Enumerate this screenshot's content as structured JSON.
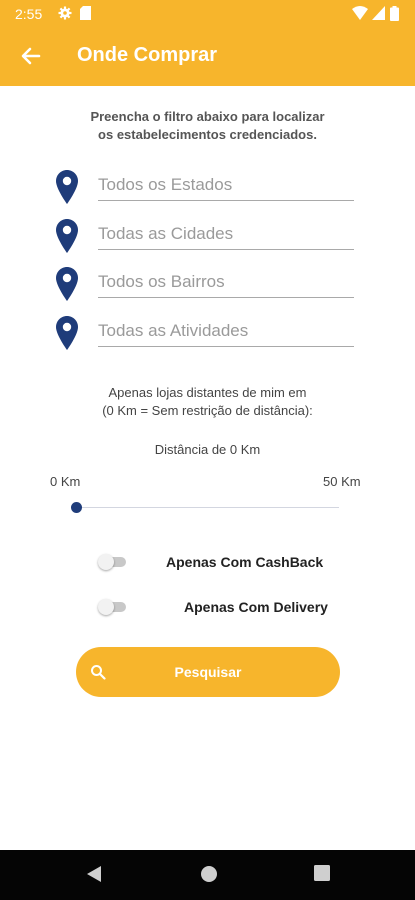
{
  "status_bar": {
    "time": "2:55",
    "icons": [
      "gear-icon",
      "sd-card-icon",
      "wifi-icon",
      "signal-icon",
      "battery-icon"
    ]
  },
  "app_bar": {
    "title": "Onde Comprar",
    "back_icon": "arrow-left-icon"
  },
  "intro_text": {
    "line1": "Preencha o filtro abaixo para localizar",
    "line2": "os estabelecimentos credenciados."
  },
  "filters": [
    {
      "icon": "map-pin-icon",
      "placeholder": "Todos os Estados"
    },
    {
      "icon": "map-pin-icon",
      "placeholder": "Todas as Cidades"
    },
    {
      "icon": "map-pin-icon",
      "placeholder": "Todos os Bairros"
    },
    {
      "icon": "map-pin-icon",
      "placeholder": "Todas as Atividades"
    }
  ],
  "distance": {
    "info_line1": "Apenas lojas distantes de mim em",
    "info_line2": "(0 Km = Sem restrição de distância):",
    "value_label": "Distância de 0 Km",
    "min_label": "0 Km",
    "max_label": "50 Km",
    "slider_value": 0,
    "slider_min": 0,
    "slider_max": 50
  },
  "toggles": [
    {
      "label": "Apenas Com CashBack",
      "on": false
    },
    {
      "label": "Apenas Com Delivery",
      "on": false
    }
  ],
  "search_button": {
    "label": "Pesquisar",
    "icon": "search-icon"
  },
  "colors": {
    "primary": "#f7b52c",
    "pin": "#1f3c7a",
    "nav_bar": "#050505"
  },
  "nav_bar": {
    "buttons": [
      "back-triangle-icon",
      "home-circle-icon",
      "recents-square-icon"
    ]
  }
}
